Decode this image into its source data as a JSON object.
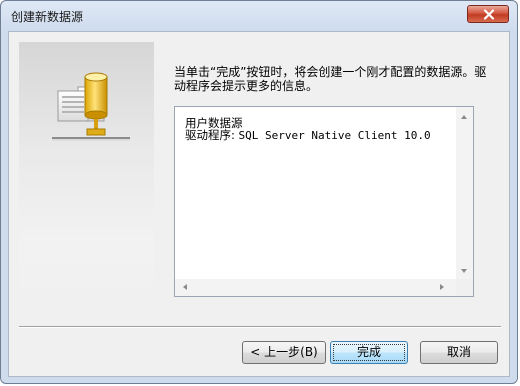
{
  "window": {
    "title": "创建新数据源"
  },
  "content": {
    "description": "当单击“完成”按钮时，将会创建一个刚才配置的数据源。驱动程序会提示更多的信息。",
    "details": {
      "line1": "用户数据源",
      "driver_label": "驱动程序:",
      "driver_value": "SQL Server Native Client 10.0"
    }
  },
  "buttons": {
    "back": "< 上一步(B)",
    "finish": "完成",
    "cancel": "取消"
  },
  "icons": {
    "close": "close-icon",
    "wizard": "datasource-wizard-icon"
  }
}
